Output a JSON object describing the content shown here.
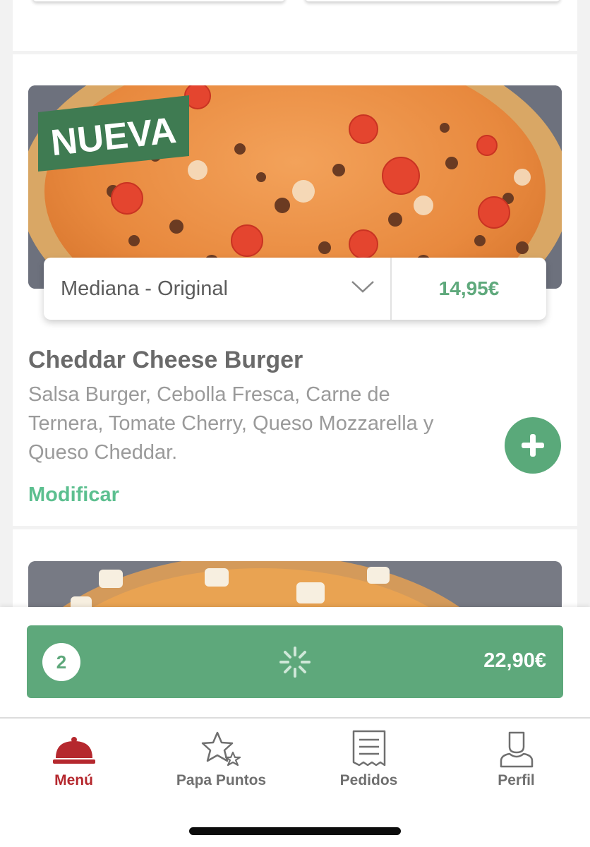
{
  "product": {
    "badge": "NUEVA",
    "size_selected": "Mediana - Original",
    "price": "14,95€",
    "title": "Cheddar Cheese Burger",
    "description": "Salsa Burger, Cebolla Fresca, Carne de Ternera, Tomate Cherry, Queso Mozzarella y Queso Cheddar.",
    "modify_label": "Modificar"
  },
  "cart": {
    "count": "2",
    "total": "22,90€"
  },
  "tabbar": {
    "items": [
      {
        "label": "Menú",
        "icon": "cloche-icon",
        "active": true
      },
      {
        "label": "Papa Puntos",
        "icon": "stars-icon",
        "active": false
      },
      {
        "label": "Pedidos",
        "icon": "receipt-icon",
        "active": false
      },
      {
        "label": "Perfil",
        "icon": "person-icon",
        "active": false
      }
    ]
  },
  "colors": {
    "accent_green": "#5ea87b",
    "link_green": "#5cbf8f",
    "active_red": "#b5282e",
    "badge_green": "#3f7b52"
  }
}
